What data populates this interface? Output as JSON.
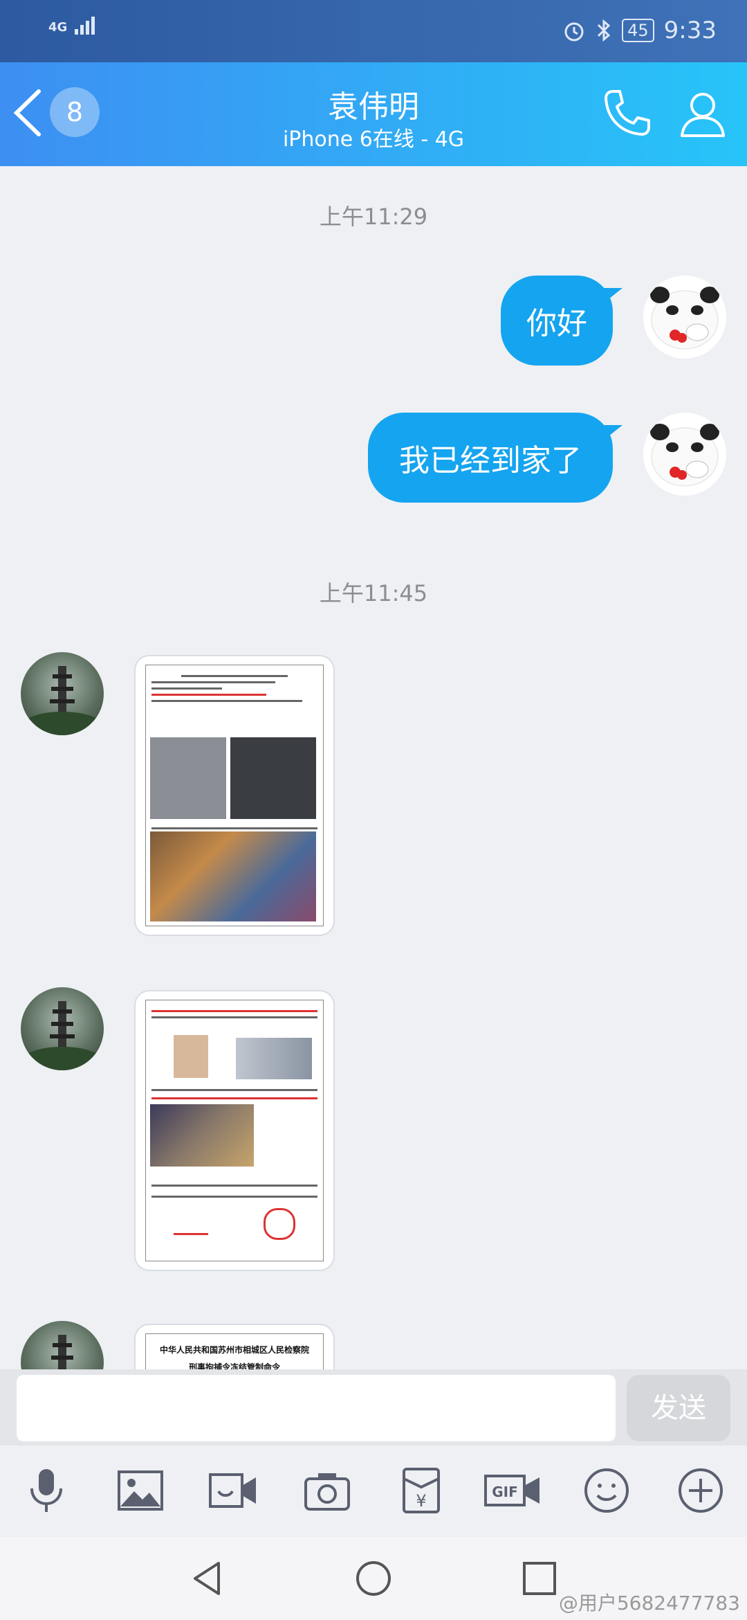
{
  "status_bar": {
    "network": "4G",
    "time": "9:33",
    "battery": "45"
  },
  "header": {
    "unread_count": "8",
    "contact_name": "袁伟明",
    "contact_status": "iPhone 6在线 - 4G"
  },
  "messages": {
    "time_1": "上午11:29",
    "msg_1": "你好",
    "msg_2": "我已经到家了",
    "time_2": "上午11:45",
    "doc3_line1": "中华人民共和国苏州市相城区人民检察院",
    "doc3_line2": "刑事拘捕令冻结管制命令"
  },
  "input": {
    "send_label": "发送"
  },
  "watermark": "@用户5682477783",
  "colors": {
    "accent": "#15a4ef",
    "header_start": "#3d8ff2",
    "header_end": "#27c4f8"
  }
}
